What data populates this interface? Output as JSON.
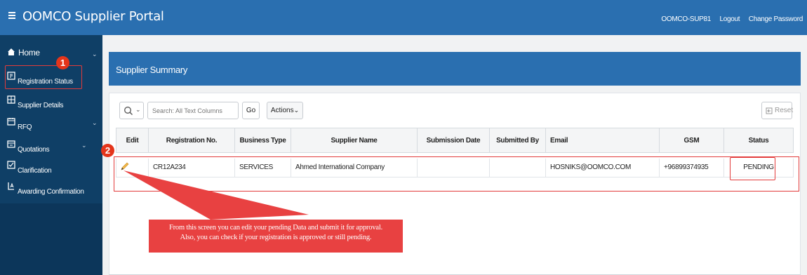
{
  "header": {
    "title": "OOMCO Supplier Portal",
    "user": "OOMCO-SUP81",
    "logout_label": "Logout",
    "change_password_label": "Change Password",
    "menu_icon": "hamburger-icon"
  },
  "sidebar": {
    "items": [
      {
        "label": "Home",
        "icon": "home-icon",
        "has_chevron": true
      },
      {
        "label": "Registration Status",
        "icon": "registration-icon",
        "has_chevron": false
      },
      {
        "label": "Supplier Details",
        "icon": "details-icon",
        "has_chevron": false
      },
      {
        "label": "RFQ",
        "icon": "rfq-icon",
        "has_chevron": true
      },
      {
        "label": "Quotations",
        "icon": "quotations-icon",
        "has_chevron": true
      },
      {
        "label": "Clarification",
        "icon": "clarification-icon",
        "has_chevron": false
      },
      {
        "label": "Awarding Confirmation",
        "icon": "award-icon",
        "has_chevron": false
      }
    ]
  },
  "badges": {
    "one": "1",
    "two": "2"
  },
  "panel": {
    "title": "Supplier Summary"
  },
  "toolbar": {
    "search_placeholder": "Search: All Text Columns",
    "go_label": "Go",
    "actions_label": "Actions",
    "reset_label": "Reset"
  },
  "grid": {
    "columns": [
      "Edit",
      "Registration No.",
      "Business Type",
      "Supplier Name",
      "Submission Date",
      "Submitted By",
      "Email",
      "GSM",
      "Status"
    ],
    "rows": [
      {
        "edit": "pencil-icon",
        "registration_no": "CR12A234",
        "business_type": "SERVICES",
        "supplier_name": "Ahmed International Company",
        "submission_date": "",
        "submitted_by": "",
        "email": "HOSNIKS@OOMCO.COM",
        "gsm": "+96899374935",
        "status": "PENDING"
      }
    ]
  },
  "callout": {
    "line1": "From this screen you can edit your pending Data and submit it for approval.",
    "line2": "Also, you can check if your registration is approved or still pending."
  },
  "colors": {
    "header_blue": "#2a6fb0",
    "sidebar_navy": "#0f3f66",
    "annotation_red": "#e84141"
  }
}
